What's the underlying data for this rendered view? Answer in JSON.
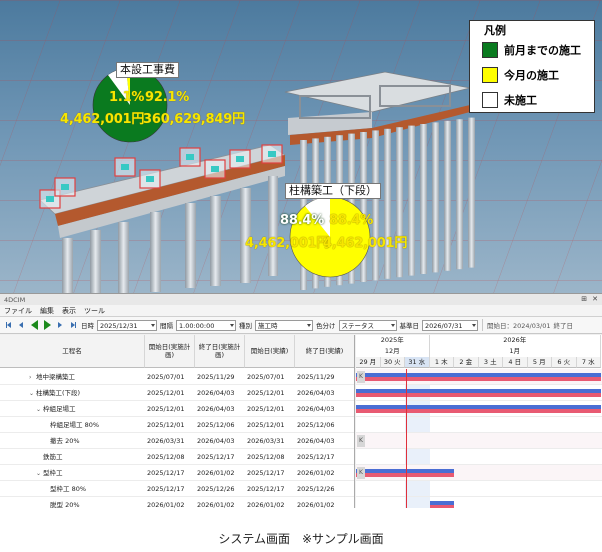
{
  "view3d": {
    "legend": {
      "title": "凡例",
      "items": [
        {
          "label": "前月までの施工",
          "color": "#0a7a1f"
        },
        {
          "label": "今月の施工",
          "color": "#ffff00"
        },
        {
          "label": "未施工",
          "color": "#ffffff"
        }
      ]
    },
    "pie_main": {
      "label": "本設工事費",
      "left_percent": "1.1%",
      "right_percent": "92.1%",
      "left_amount": "4,462,001円",
      "right_amount": "360,629,849円",
      "previous_fraction": 0.921,
      "current_fraction": 0.011
    },
    "pie_sub": {
      "label": "柱構築工（下段）",
      "left_percent": "88.4%",
      "right_percent": "88.4%",
      "left_amount": "4,462,001円",
      "right_amount": "4,462,001円",
      "previous_fraction": 0.0,
      "current_fraction": 0.884
    }
  },
  "app": {
    "title": "4DCIM",
    "menu": [
      "ファイル",
      "編集",
      "表示",
      "ツール"
    ],
    "toolbar": {
      "date_label": "日時",
      "date_value": "2025/12/31",
      "interval_label": "間隔",
      "interval_value": "1.00:00:00",
      "kind_label": "種別",
      "kind_value": "施工時",
      "color_label": "色分け",
      "color_value": "ステータス",
      "base_label": "基準日",
      "base_value": "2026/07/31",
      "start_text": "開始日：2024/03/01",
      "end_text": "終了日"
    },
    "grid": {
      "headers": [
        "工程名",
        "開始日(実施計画)",
        "終了日(実施計画)",
        "開始日(実績)",
        "終了日(実績)"
      ],
      "rows": [
        {
          "name": "地中梁構築工",
          "indent": 1,
          "twisty": "›",
          "c1": "2025/07/01",
          "c2": "2025/11/29",
          "c3": "2025/07/01",
          "c4": "2025/11/29"
        },
        {
          "name": "柱構築工(下段)",
          "indent": 1,
          "twisty": "⌄",
          "c1": "2025/12/01",
          "c2": "2026/04/03",
          "c3": "2025/12/01",
          "c4": "2026/04/03"
        },
        {
          "name": "枠組足場工",
          "indent": 2,
          "twisty": "⌄",
          "c1": "2025/12/01",
          "c2": "2026/04/03",
          "c3": "2025/12/01",
          "c4": "2026/04/03"
        },
        {
          "name": "枠組足場工  80%",
          "indent": 3,
          "twisty": "",
          "c1": "2025/12/01",
          "c2": "2025/12/06",
          "c3": "2025/12/01",
          "c4": "2025/12/06"
        },
        {
          "name": "撤去  20%",
          "indent": 3,
          "twisty": "",
          "c1": "2026/03/31",
          "c2": "2026/04/03",
          "c3": "2026/03/31",
          "c4": "2026/04/03"
        },
        {
          "name": "鉄筋工",
          "indent": 2,
          "twisty": "",
          "c1": "2025/12/08",
          "c2": "2025/12/17",
          "c3": "2025/12/08",
          "c4": "2025/12/17"
        },
        {
          "name": "型枠工",
          "indent": 2,
          "twisty": "⌄",
          "c1": "2025/12/17",
          "c2": "2026/01/02",
          "c3": "2025/12/17",
          "c4": "2026/01/02"
        },
        {
          "name": "型枠工  80%",
          "indent": 3,
          "twisty": "",
          "c1": "2025/12/17",
          "c2": "2025/12/26",
          "c3": "2025/12/17",
          "c4": "2025/12/26"
        },
        {
          "name": "脱型  20%",
          "indent": 3,
          "twisty": "",
          "c1": "2026/01/02",
          "c2": "2026/01/02",
          "c3": "2026/01/02",
          "c4": "2026/01/02"
        }
      ]
    },
    "gantt": {
      "years": [
        {
          "label": "2025年"
        },
        {
          "label": "2026年"
        }
      ],
      "months": [
        {
          "label": "12月"
        },
        {
          "label": "1月"
        }
      ],
      "days": [
        "29 月",
        "30 火",
        "31 水",
        "1 木",
        "2 金",
        "3 土",
        "4 日",
        "5 月",
        "6 火",
        "7 水"
      ]
    }
  },
  "caption": "システム画面　※サンプル画面"
}
